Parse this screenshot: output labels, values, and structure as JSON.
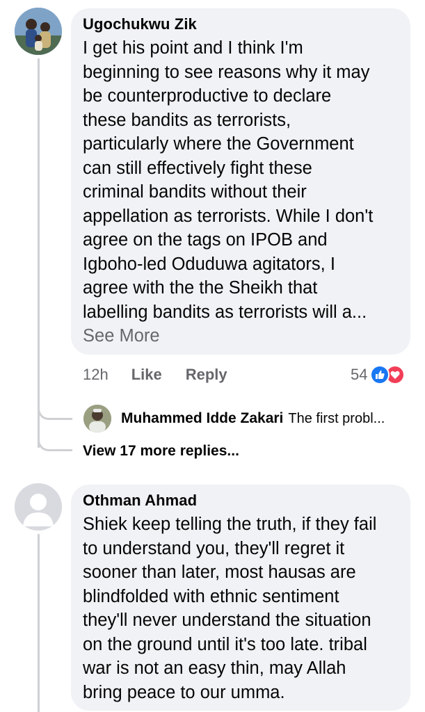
{
  "comments": [
    {
      "author": "Ugochukwu Zik",
      "lines": [
        "I get his point and I think I'm",
        "beginning to see reasons why it may",
        "be counterproductive to declare",
        "these bandits as terrorists,",
        "particularly where the Government",
        "can still effectively fight these",
        "criminal bandits without their",
        "appellation as terrorists. While I don't",
        "agree on the tags on IPOB and",
        "Igboho-led Oduduwa agitators, I",
        "agree with the the Sheikh that",
        "labelling bandits as terrorists will a..."
      ],
      "see_more": "See More",
      "time": "12h",
      "like_label": "Like",
      "reply_label": "Reply",
      "reaction_count": "54",
      "reactions": [
        "like-reaction",
        "love-reaction"
      ],
      "reaction_colors": {
        "like": "#1877f2",
        "love": "#f33e58"
      }
    },
    {
      "author": "Othman Ahmad",
      "lines": [
        "Shiek keep telling the truth, if they fail",
        "to understand you, they'll regret it",
        "sooner than later, most hausas are",
        "blindfolded with ethnic sentiment",
        "they'll never understand the situation",
        "on the ground until it's too late. tribal",
        "war is not an easy thin, may Allah",
        "bring peace to our umma."
      ]
    }
  ],
  "reply_preview": {
    "author": "Muhammed Idde Zakari",
    "text": "The first probl..."
  },
  "view_more_replies": "View 17 more replies..."
}
